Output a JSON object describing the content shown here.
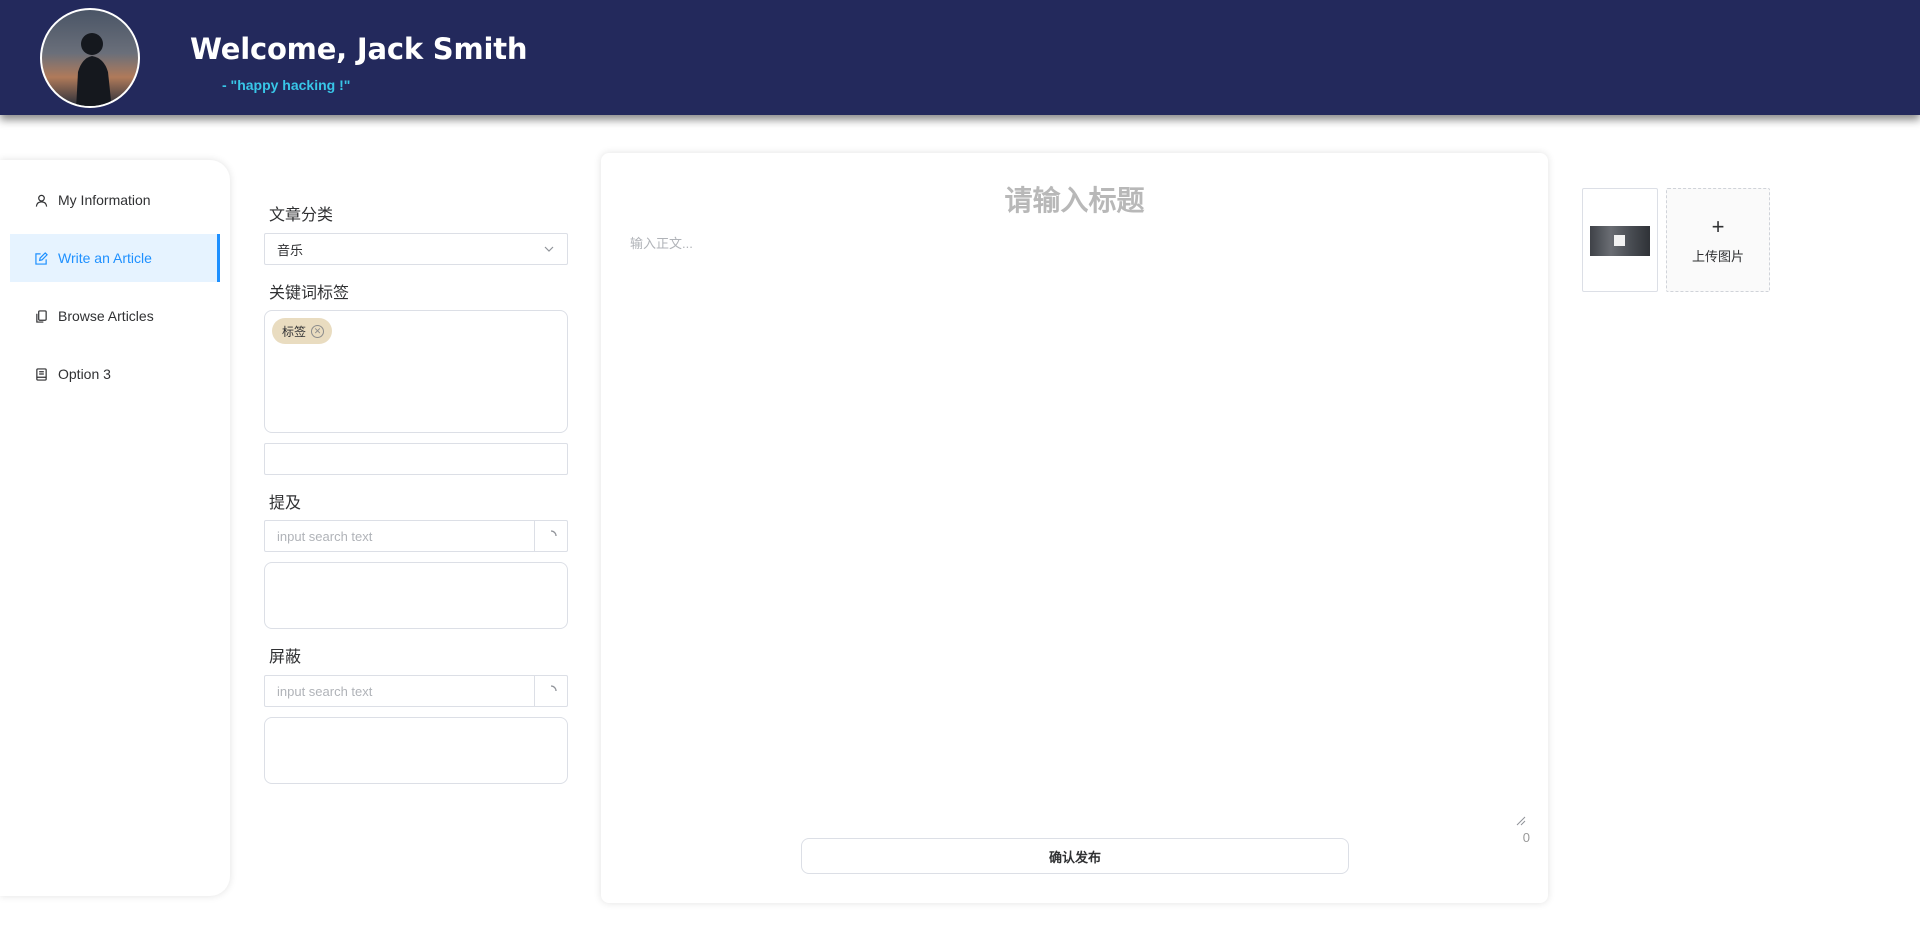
{
  "header": {
    "welcome": "Welcome, Jack Smith",
    "motto": "- \"happy hacking !\""
  },
  "sidebar": {
    "items": [
      {
        "label": "My Information",
        "icon": "user-icon"
      },
      {
        "label": "Write an Article",
        "icon": "edit-icon",
        "active": true
      },
      {
        "label": "Browse Articles",
        "icon": "documents-icon"
      },
      {
        "label": "Option 3",
        "icon": "notebook-icon"
      }
    ]
  },
  "form": {
    "category_label": "文章分类",
    "category_value": "音乐",
    "keywords_label": "关键词标签",
    "keyword_tags": [
      "标签"
    ],
    "mention_label": "提及",
    "mention_placeholder": "input search text",
    "block_label": "屏蔽",
    "block_placeholder": "input search text"
  },
  "editor": {
    "title_placeholder": "请输入标题",
    "body_placeholder": "输入正文...",
    "char_count": "0",
    "publish_label": "确认发布"
  },
  "upload": {
    "label": "上传图片"
  },
  "colors": {
    "header_bg": "#23295c",
    "accent": "#1e90ff",
    "motto": "#38c6e8",
    "tag_bg": "#e9dcc0"
  }
}
